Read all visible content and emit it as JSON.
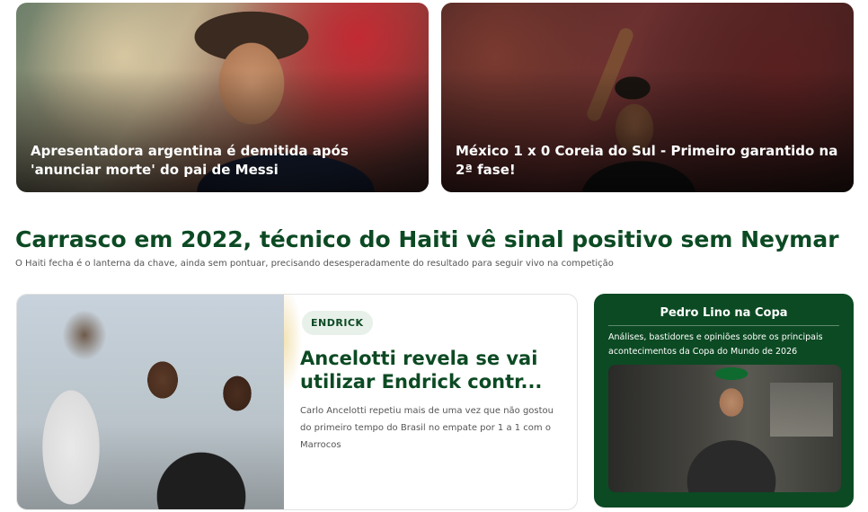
{
  "top_cards": [
    {
      "caption": "Apresentadora argentina é demitida após 'anunciar morte' do pai de Messi"
    },
    {
      "caption": "México 1 x 0 Coreia do Sul - Primeiro garantido na 2ª fase!"
    }
  ],
  "headline": {
    "title": "Carrasco em 2022, técnico do Haiti vê sinal positivo sem Neymar",
    "subtitle": "O Haiti fecha é o lanterna da chave, ainda sem pontuar, precisando desesperadamente do resultado para seguir vivo na competição"
  },
  "feature": {
    "badge": "ENDRICK",
    "title": "Ancelotti revela se vai utilizar Endrick contr...",
    "description": "Carlo Ancelotti repetiu mais de uma vez que não gostou do primeiro tempo do Brasil no empate por 1 a 1 com o Marrocos"
  },
  "column": {
    "title": "Pedro Lino na Copa",
    "description": "Análises, bastidores e opiniões sobre os principais acontecimentos da Copa do Mundo de 2026"
  },
  "colors": {
    "brand_green": "#0c4a23",
    "badge_bg": "#e8f0ea"
  }
}
